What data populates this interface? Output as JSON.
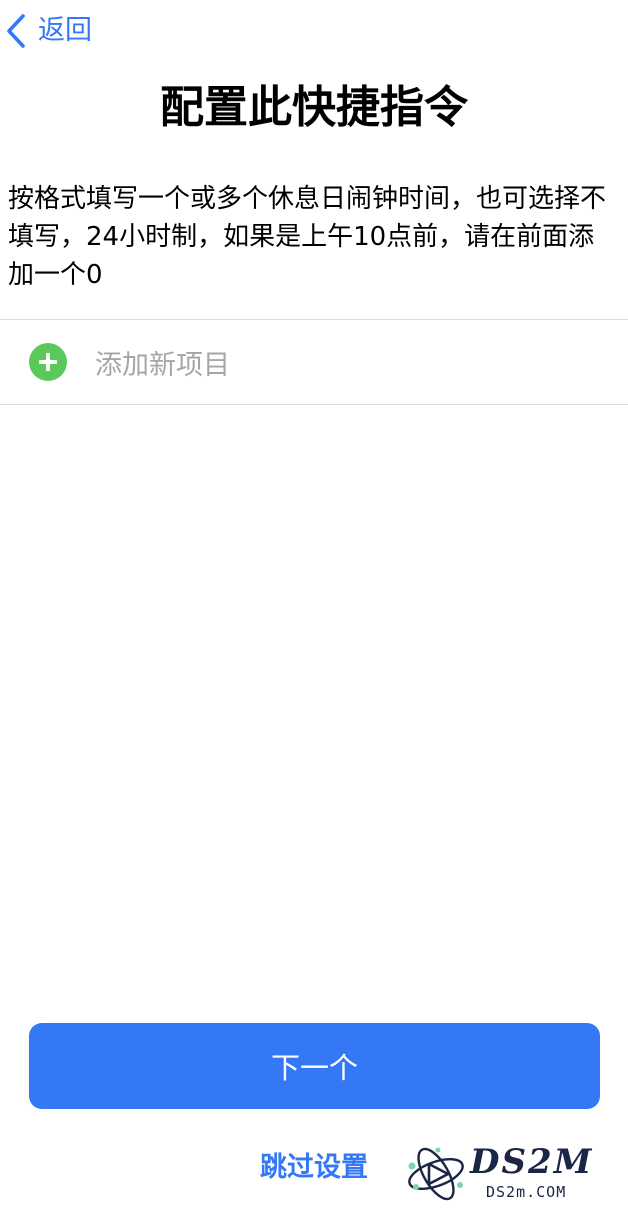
{
  "nav": {
    "back_label": "返回"
  },
  "page": {
    "title": "配置此快捷指令",
    "description": "按格式填写一个或多个休息日闹钟时间，也可选择不填写，24小时制，如果是上午10点前，请在前面添加一个0"
  },
  "list": {
    "add_item_label": "添加新项目"
  },
  "actions": {
    "next_label": "下一个",
    "skip_label": "跳过设置"
  },
  "watermark": {
    "brand": "DS2M",
    "domain": "DS2m.COM"
  },
  "colors": {
    "accent": "#3478f6",
    "add_icon_green": "#5ac85a",
    "placeholder_gray": "#a6a6a6",
    "divider": "#dcdcdc"
  },
  "icons": {
    "back": "chevron-left-icon",
    "add": "plus-circle-icon",
    "watermark_logo": "atom-logo-icon"
  }
}
